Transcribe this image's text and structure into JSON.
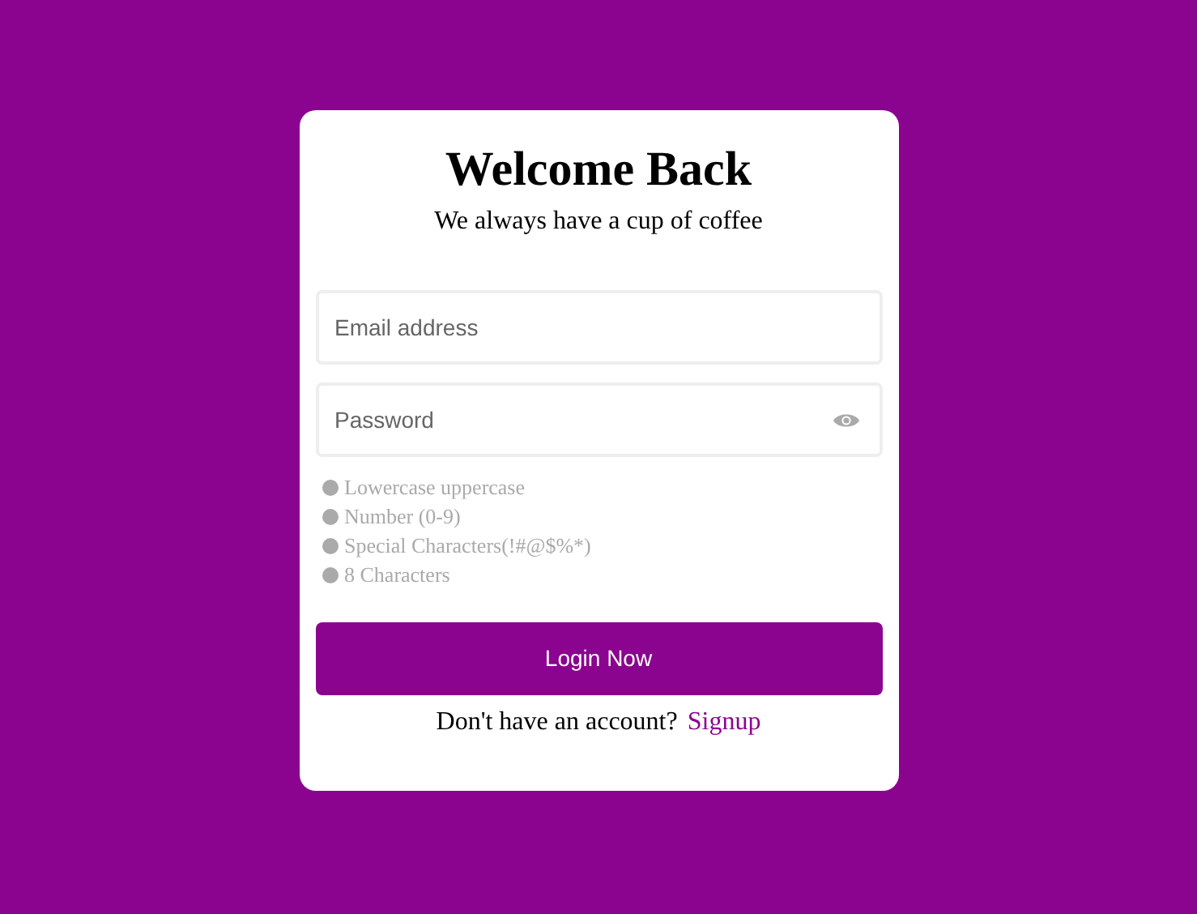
{
  "title": "Welcome Back",
  "subtitle": "We always have a cup of coffee",
  "email": {
    "placeholder": "Email address"
  },
  "password": {
    "placeholder": "Password"
  },
  "requirements": [
    {
      "label": "Lowercase uppercase",
      "met": false
    },
    {
      "label": "Number (0-9)",
      "met": false
    },
    {
      "label": "Special Characters(!#@$%*)",
      "met": false
    },
    {
      "label": "8 Characters",
      "met": false
    }
  ],
  "login_button": "Login Now",
  "signup_prompt": "Don't have an account?",
  "signup_link": "Signup"
}
